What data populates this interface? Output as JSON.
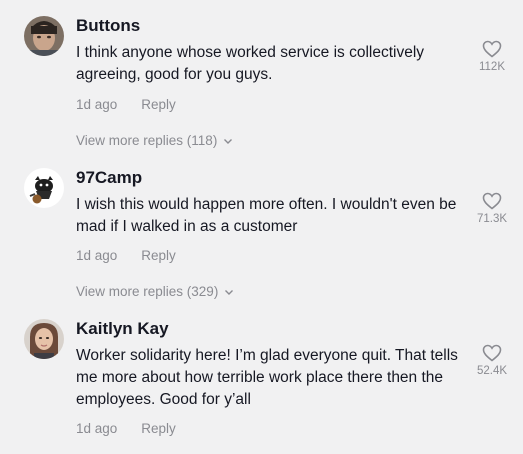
{
  "comments": [
    {
      "username": "Buttons",
      "text": "I think anyone whose worked service is collectively agreeing, good for you guys.",
      "time": "1d ago",
      "reply_label": "Reply",
      "like_count": "112K",
      "more_replies": "View more replies (118)"
    },
    {
      "username": "97Camp",
      "text": "I wish this would happen more often. I wouldn't even be mad if I walked in as a customer",
      "time": "1d ago",
      "reply_label": "Reply",
      "like_count": "71.3K",
      "more_replies": "View more replies (329)"
    },
    {
      "username": "Kaitlyn Kay",
      "text": "Worker solidarity here! I’m glad everyone quit. That tells me more about how terrible work place there then the employees. Good for y’all",
      "time": "1d ago",
      "reply_label": "Reply",
      "like_count": "52.4K"
    }
  ],
  "icons": {
    "like": "heart-outline-icon",
    "expand": "chevron-down-icon"
  },
  "colors": {
    "background": "#f1f1f2",
    "primary_text": "#161823",
    "secondary_text": "#8a8b91"
  }
}
